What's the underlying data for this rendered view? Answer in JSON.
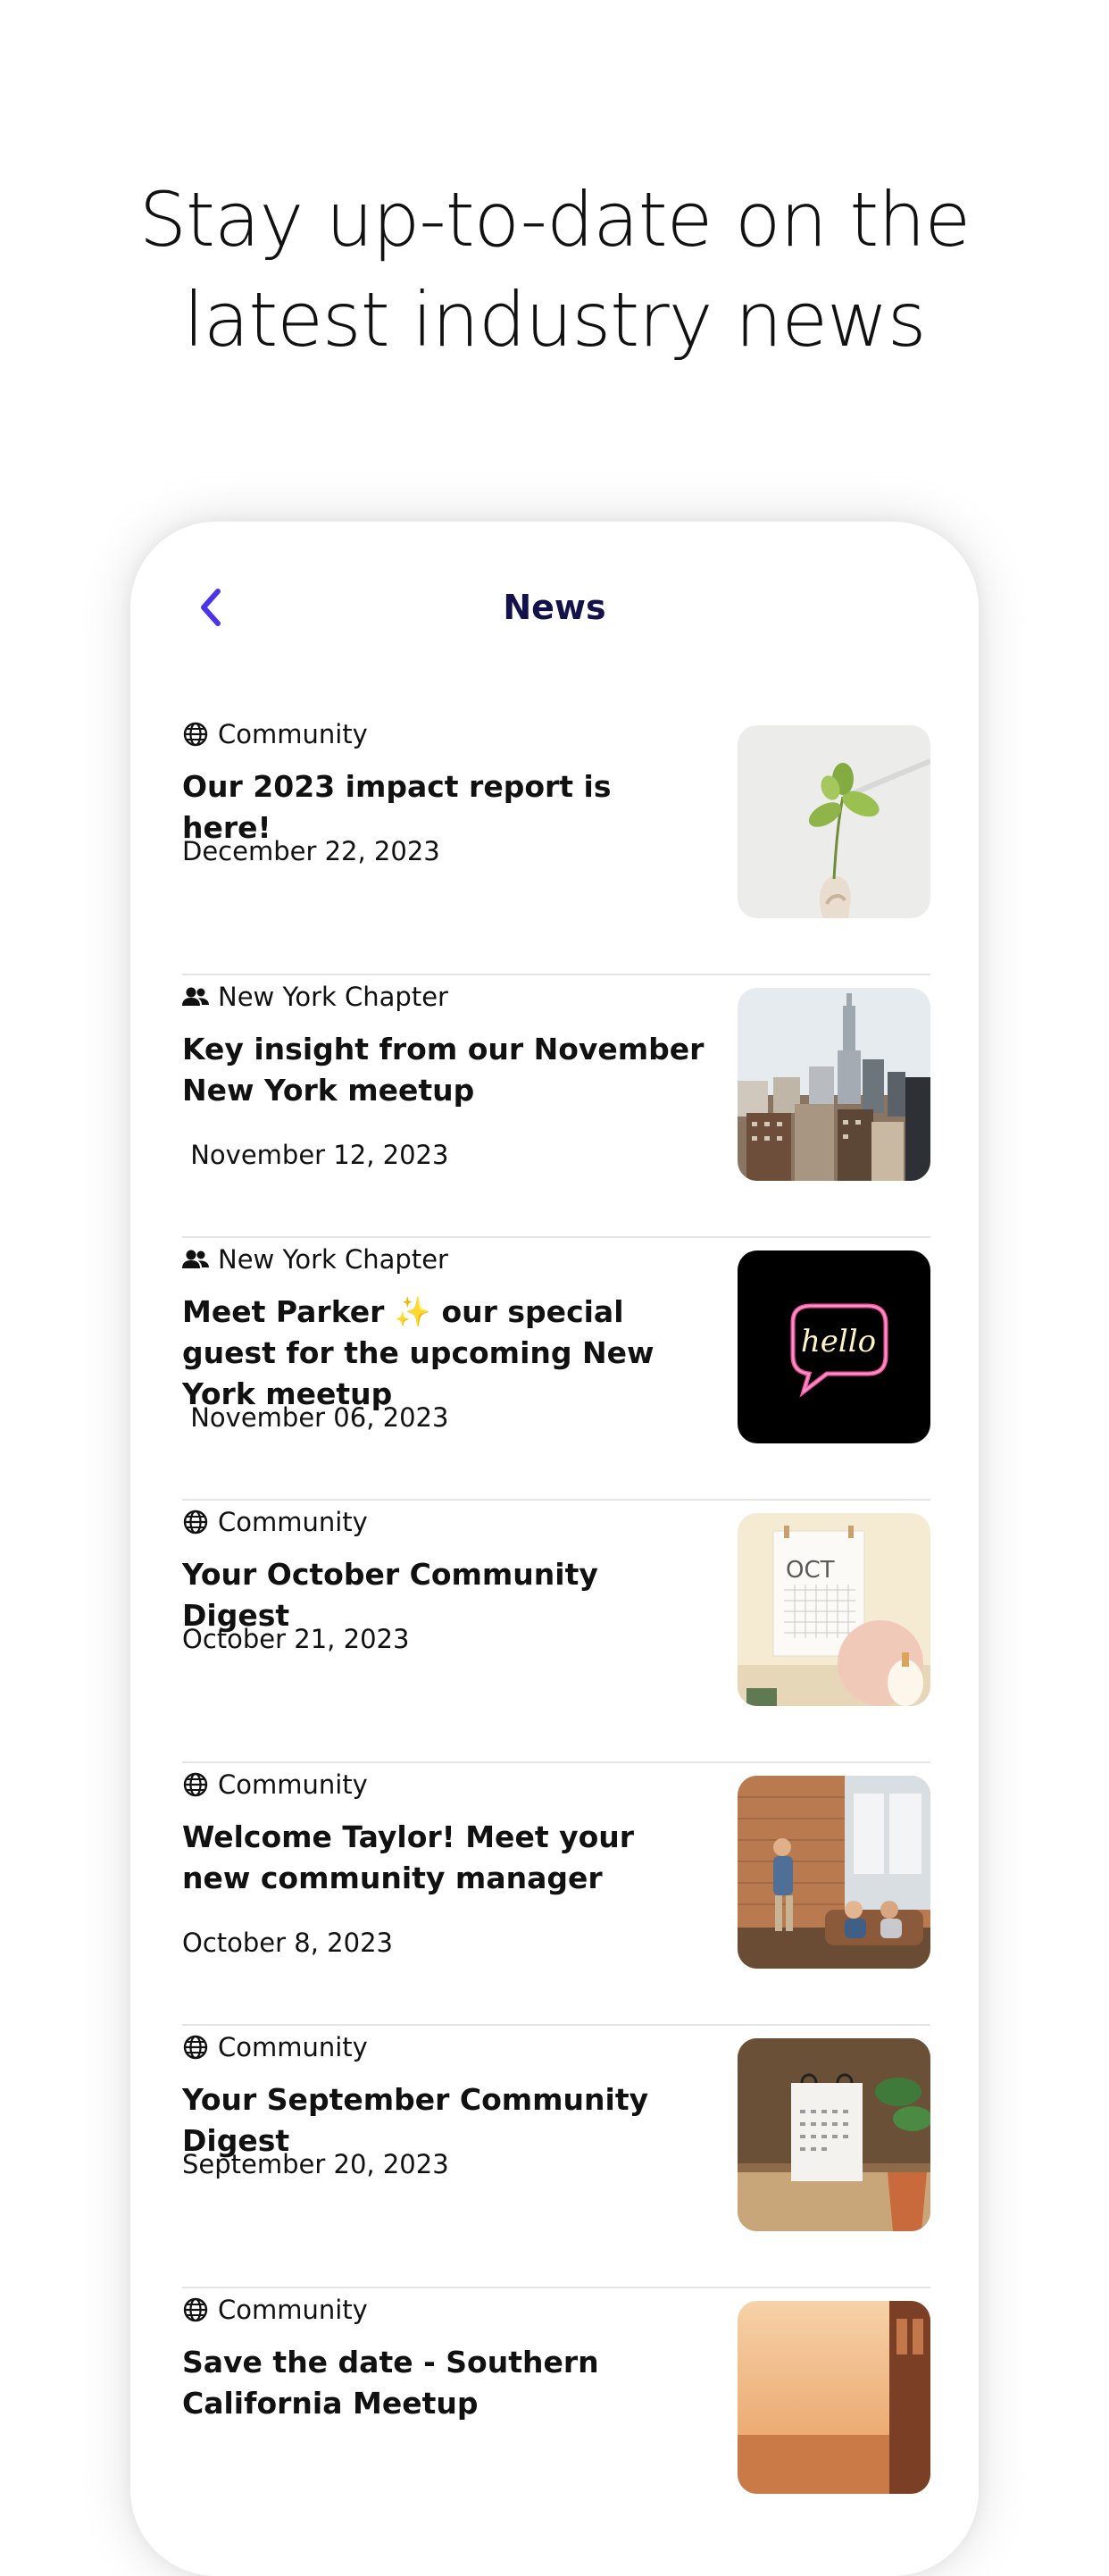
{
  "headline": {
    "line1": "Stay up-to-date on the",
    "line2": "latest industry news"
  },
  "nav": {
    "title": "News",
    "back_icon": "chevron-left-icon",
    "accent_color": "#4a35e8"
  },
  "news": [
    {
      "category": "Community",
      "category_icon": "globe-icon",
      "title": "Our 2023 impact report is here!",
      "date": "December 22, 2023",
      "image": "plant-sprout-image"
    },
    {
      "category": "New York Chapter",
      "category_icon": "people-icon",
      "title": "Key insight from our November New York meetup",
      "date": " November 12, 2023",
      "image": "city-skyline-image"
    },
    {
      "category": "New York Chapter",
      "category_icon": "people-icon",
      "title": "Meet Parker ✨ our special guest for the upcoming New York meetup",
      "date": " November 06, 2023",
      "image": "neon-hello-sign-image"
    },
    {
      "category": "Community",
      "category_icon": "globe-icon",
      "title": "Your October Community Digest",
      "date": "October 21, 2023",
      "image": "october-calendar-image"
    },
    {
      "category": "Community",
      "category_icon": "globe-icon",
      "title": "Welcome Taylor! Meet your new community manager",
      "date": "October 8, 2023",
      "image": "meetup-presentation-image"
    },
    {
      "category": "Community",
      "category_icon": "globe-icon",
      "title": "Your September Community Digest",
      "date": "September 20, 2023",
      "image": "desk-calendar-image"
    },
    {
      "category": "Community",
      "category_icon": "globe-icon",
      "title": "Save the date - Southern California Meetup",
      "date": "",
      "image": "sunset-city-image"
    }
  ],
  "thumb_texts": {
    "neon": "hello",
    "calendar_month": "OCT"
  }
}
